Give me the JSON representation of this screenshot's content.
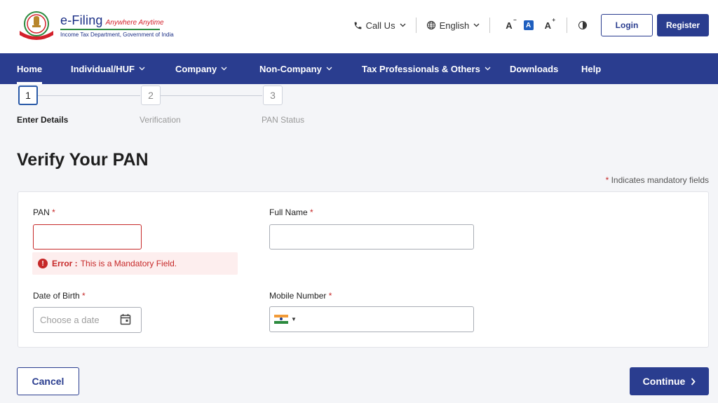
{
  "colors": {
    "primary": "#2a3d8f",
    "error": "#c62828",
    "step_active": "#2a5aa8"
  },
  "header": {
    "logo": {
      "brand": "e-Filing",
      "tagline": "Anywhere Anytime",
      "subtitle": "Income Tax Department, Government of India",
      "emblem_text": "INCOME TAX DEPARTMENT",
      "emblem_icon": "national-emblem-icon"
    },
    "call_us": "Call Us",
    "language": "English",
    "font_decrease": "A",
    "font_default": "A",
    "font_increase": "A",
    "login": "Login",
    "register": "Register"
  },
  "nav": {
    "items": [
      {
        "label": "Home",
        "dropdown": false,
        "active": true
      },
      {
        "label": "Individual/HUF",
        "dropdown": true
      },
      {
        "label": "Company",
        "dropdown": true
      },
      {
        "label": "Non-Company",
        "dropdown": true
      },
      {
        "label": "Tax Professionals & Others",
        "dropdown": true
      },
      {
        "label": "Downloads",
        "dropdown": false
      },
      {
        "label": "Help",
        "dropdown": false
      }
    ]
  },
  "stepper": {
    "steps": [
      {
        "number": "1",
        "label": "Enter Details",
        "state": "active"
      },
      {
        "number": "2",
        "label": "Verification",
        "state": "inactive"
      },
      {
        "number": "3",
        "label": "PAN Status",
        "state": "inactive"
      }
    ]
  },
  "page": {
    "title": "Verify Your PAN",
    "mandatory_star": "*",
    "mandatory_note": "Indicates mandatory fields"
  },
  "form": {
    "pan": {
      "label": "PAN",
      "required": "*",
      "value": ""
    },
    "error": {
      "prefix": "Error :",
      "message": "This is a Mandatory Field."
    },
    "full_name": {
      "label": "Full Name",
      "required": "*",
      "value": ""
    },
    "dob": {
      "label": "Date of Birth",
      "required": "*",
      "placeholder": "Choose a date"
    },
    "mobile": {
      "label": "Mobile Number",
      "required": "*",
      "value": "",
      "country_flag": "india-flag-icon"
    }
  },
  "actions": {
    "cancel": "Cancel",
    "continue": "Continue"
  }
}
